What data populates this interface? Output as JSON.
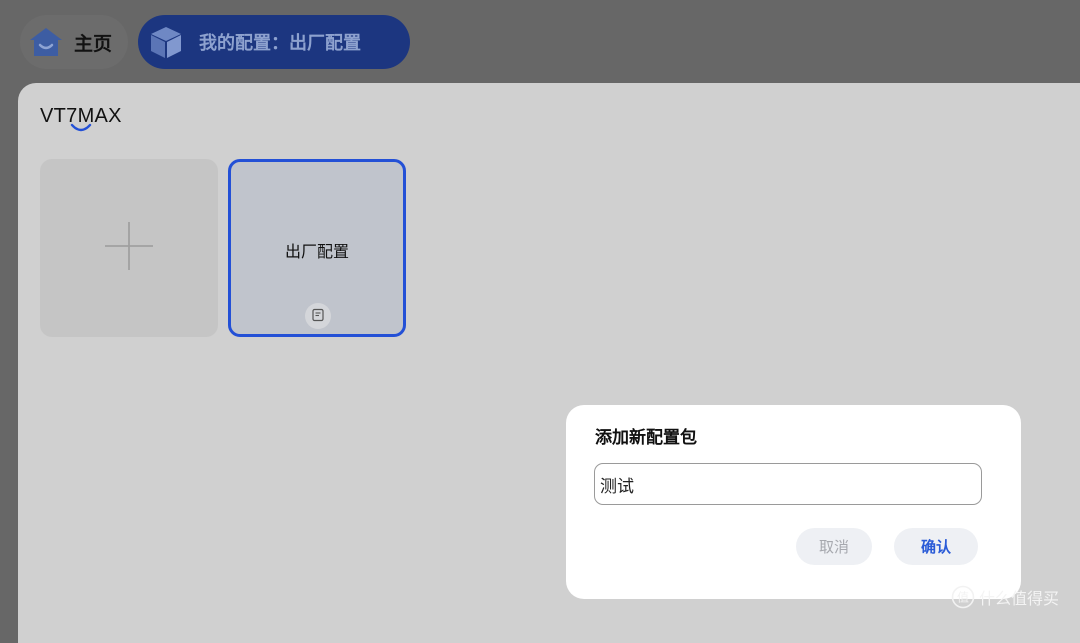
{
  "topbar": {
    "home_label": "主页",
    "config_label": "我的配置：出厂配置",
    "home_icon": "home-icon",
    "config_icon": "box-icon"
  },
  "panel": {
    "device_name": "VT7MAX",
    "add_card_icon": "plus-icon",
    "profiles": [
      {
        "name": "出厂配置",
        "selected": true,
        "icon": "document-icon"
      }
    ]
  },
  "dialog": {
    "title": "添加新配置包",
    "input_value": "测试",
    "cancel_label": "取消",
    "confirm_label": "确认"
  },
  "watermark": {
    "text": "什么值得买"
  },
  "colors": {
    "accent": "#2350d6",
    "pill_active": "#1c3680",
    "panel_bg": "#d0d0d0",
    "overlay_bg": "#676767"
  }
}
